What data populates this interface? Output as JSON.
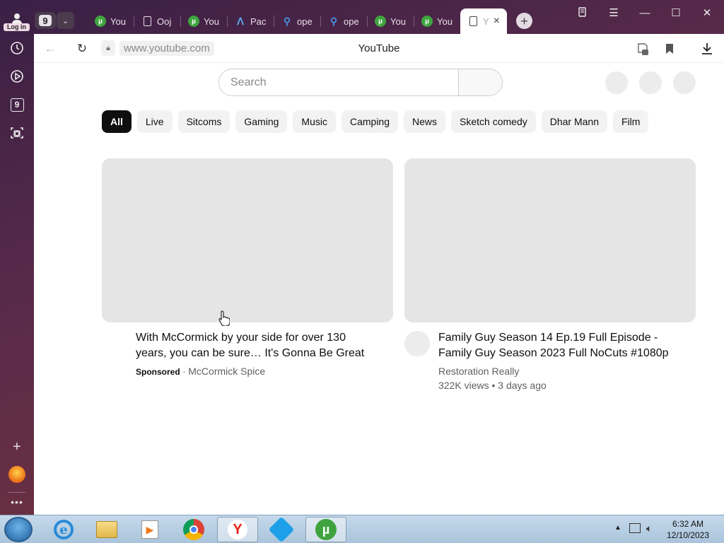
{
  "sidebar": {
    "login_label": "Log in",
    "tab_count_badge": "9",
    "icons": [
      "history-icon",
      "player-icon",
      "nine-tabs-icon",
      "screenshot-icon",
      "add-icon",
      "extension-icon",
      "more-icon"
    ]
  },
  "tabstrip": {
    "tab_count": "9",
    "tabs": [
      {
        "label": "You",
        "icon": "utorrent-icon"
      },
      {
        "label": "Ooj",
        "icon": "document-icon"
      },
      {
        "label": "You",
        "icon": "utorrent-icon"
      },
      {
        "label": "Pac",
        "icon": "pacman-icon"
      },
      {
        "label": "ope",
        "icon": "search-icon"
      },
      {
        "label": "ope",
        "icon": "search-icon"
      },
      {
        "label": "You",
        "icon": "utorrent-icon"
      },
      {
        "label": "You",
        "icon": "utorrent-icon"
      },
      {
        "label": "Y",
        "icon": "document-icon",
        "active": true
      }
    ],
    "new_tab_symbol": "+",
    "close_symbol": "×"
  },
  "addressbar": {
    "url": "www.youtube.com",
    "page_title": "YouTube"
  },
  "youtube": {
    "search_placeholder": "Search",
    "chips": [
      "All",
      "Live",
      "Sitcoms",
      "Gaming",
      "Music",
      "Camping",
      "News",
      "Sketch comedy",
      "Dhar Mann",
      "Film"
    ],
    "videos": [
      {
        "title_line1": "With McCormick by your side for over 130",
        "title_line2": "years, you can be sure… It's Gonna Be Great",
        "sponsored": "Sponsored",
        "separator": "·",
        "channel": "McCormick Spice"
      },
      {
        "title_line1": "Family Guy Season 14 Ep.19 Full Episode -",
        "title_line2": "Family Guy Season 2023 Full NoCuts #1080p",
        "channel": "Restoration Really",
        "stats": "322K views • 3 days ago"
      }
    ]
  },
  "taskbar": {
    "apps": [
      "internet-explorer-icon",
      "file-explorer-icon",
      "media-player-icon",
      "chrome-icon",
      "yandex-icon",
      "app-icon",
      "utorrent-icon"
    ],
    "time": "6:32 AM",
    "date": "12/10/2023"
  },
  "colors": {
    "sidebar_bg": "#4a2a45",
    "chip_active": "#0f0f0f",
    "thumbnail_placeholder": "#e5e5e5"
  }
}
